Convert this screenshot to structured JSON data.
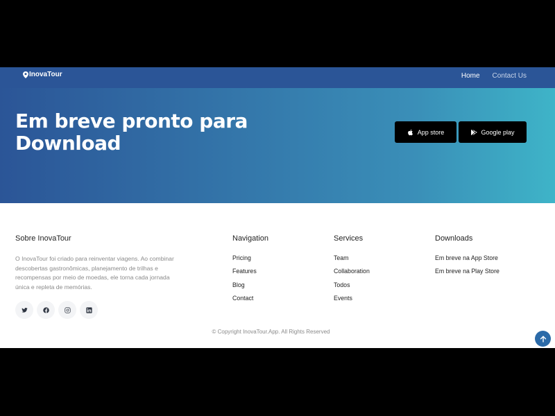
{
  "navbar": {
    "brand": "InovaTour",
    "links": [
      {
        "label": "Home",
        "active": true
      },
      {
        "label": "Contact Us",
        "active": false
      }
    ]
  },
  "hero": {
    "title_line1": "Em breve pronto para",
    "title_line2": "Download",
    "app_store_label": "App store",
    "google_play_label": "Google play"
  },
  "footer": {
    "about": {
      "title": "Sobre InovaTour",
      "text": "O InovaTour foi criado para reinventar viagens. Ao combinar descobertas gastronômicas, planejamento de trilhas e recompensas por meio de moedas, ele torna cada jornada única e repleta de memórias.",
      "socials": [
        "twitter-icon",
        "facebook-icon",
        "instagram-icon",
        "linkedin-icon"
      ]
    },
    "navigation": {
      "title": "Navigation",
      "items": [
        "Pricing",
        "Features",
        "Blog",
        "Contact"
      ]
    },
    "services": {
      "title": "Services",
      "items": [
        "Team",
        "Collaboration",
        "Todos",
        "Events"
      ]
    },
    "downloads": {
      "title": "Downloads",
      "items": [
        "Em breve na App Store",
        "Em breve na Play Store"
      ]
    },
    "copyright": "© Copyright InovaTour.App. All Rights Reserved"
  },
  "colors": {
    "navbar_bg": "#2b5597",
    "hero_gradient_start": "#2b5597",
    "hero_gradient_end": "#3eb4c8",
    "back_to_top": "#2b6aa8"
  }
}
